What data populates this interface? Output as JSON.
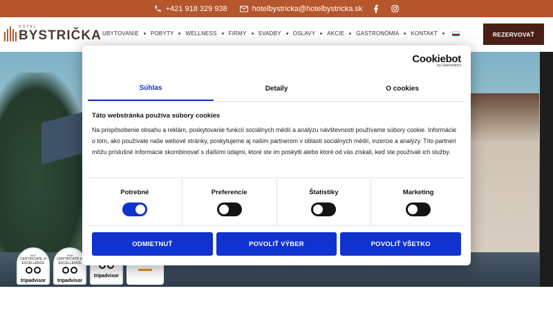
{
  "topbar": {
    "phone": "+421 918 329 938",
    "email": "hotelbystricka@hotelbystricka.sk",
    "social": [
      "facebook-icon",
      "instagram-icon"
    ],
    "bg_color": "#b5562d"
  },
  "logo": {
    "small": "HOTEL",
    "name": "BYSTRIČKA"
  },
  "nav": {
    "items": [
      "UBYTOVANIE",
      "POBYTY",
      "WELLNESS",
      "FIRMY",
      "SVADBY",
      "OSLAVY",
      "AKCIE",
      "GASTRONÓMIA",
      "KONTAKT"
    ],
    "language": "sk-flag-icon",
    "reserve_label": "REZERVOVAŤ",
    "reserve_color": "#4a1f17"
  },
  "badges": [
    {
      "label": "CERTIFICATE of EXCELLENCE",
      "year": "2017",
      "brand": "tripadvisor"
    },
    {
      "label": "CERTIFICATE of EXCELLENCE",
      "year": "2018",
      "brand": "tripadvisor"
    },
    {
      "label": "",
      "year": "",
      "brand": "tripadvisor"
    },
    {
      "label": "Travel Awards",
      "year": "",
      "brand": ""
    }
  ],
  "cookie_dialog": {
    "brand": "Cookiebot",
    "brand_sub": "by Usercentrics",
    "tabs": [
      "Súhlas",
      "Detaily",
      "O cookies"
    ],
    "active_tab": "Súhlas",
    "heading": "Táto webstránka používa súbory cookies",
    "text": "Na prispôsobenie obsahu a reklám, poskytovanie funkcií sociálnych médií a analýzu návštevnosti používame súbory cookie. Informácie o tom, ako používate naše webové stránky, poskytujeme aj našim partnerom v oblasti sociálnych médií, inzercie a analýzy. Títo partneri môžu príslušné informácie skombinovať s ďalšími údajmi, ktoré ste im poskytli alebo ktoré od vás získali, keď ste používali ich služby.",
    "toggles": [
      {
        "label": "Potrebné",
        "on": true
      },
      {
        "label": "Preferencie",
        "on": false
      },
      {
        "label": "Štatistiky",
        "on": false
      },
      {
        "label": "Marketing",
        "on": false
      }
    ],
    "buttons": [
      "ODMIETNUŤ",
      "POVOLIŤ VÝBER",
      "POVOLIŤ VŠETKO"
    ],
    "accent_color": "#1032cf"
  }
}
